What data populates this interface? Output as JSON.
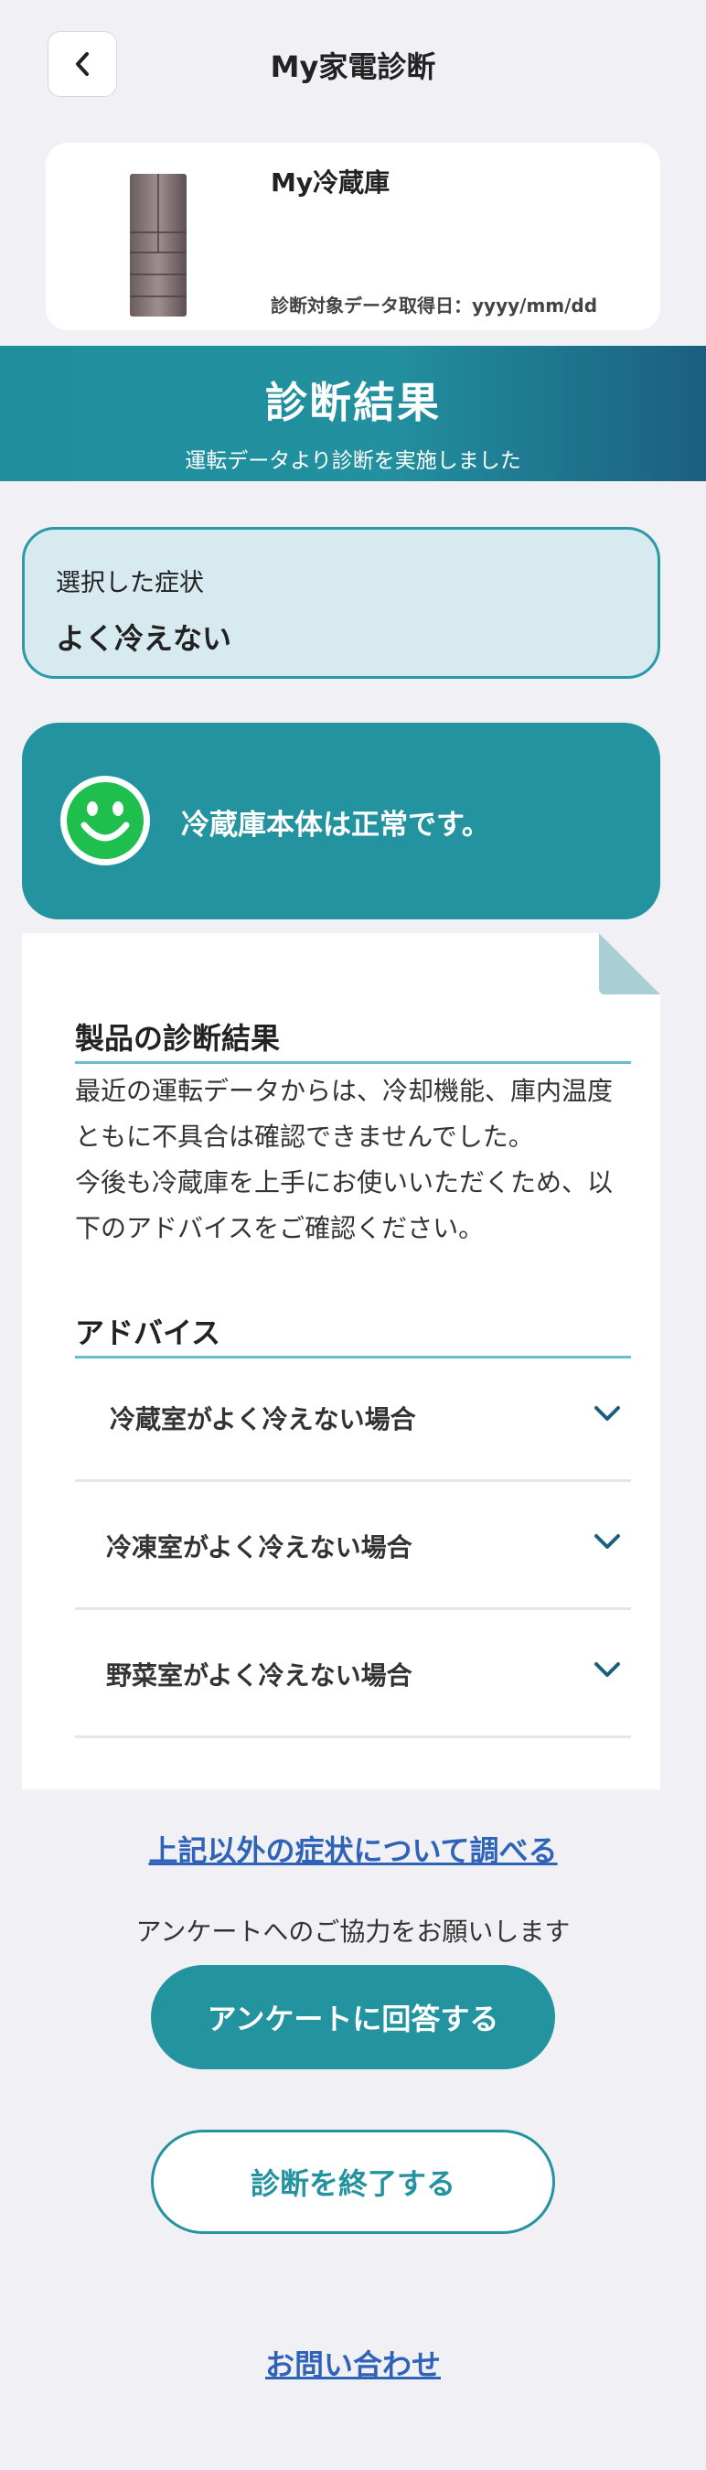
{
  "header": {
    "title": "My家電診断",
    "back_icon": "chevron-left-icon"
  },
  "product": {
    "name": "My冷蔵庫",
    "date_label": "診断対象データ取得日：yyyy/mm/dd",
    "image": "refrigerator-image"
  },
  "banner": {
    "title": "診断結果",
    "subtitle": "運転データより診断を実施しました"
  },
  "symptom": {
    "label": "選択した症状",
    "value": "よく冷えない"
  },
  "status": {
    "icon": "smile-icon",
    "text": "冷蔵庫本体は正常です。"
  },
  "result": {
    "heading": "製品の診断結果",
    "lines": [
      "最近の運転データからは、冷却機能、庫内温度",
      "ともに不具合は確認できませんでした。",
      "今後も冷蔵庫を上手にお使いいただくため、以",
      "下のアドバイスをご確認ください。"
    ]
  },
  "advice": {
    "heading": "アドバイス",
    "items": [
      {
        "label": "冷蔵室がよく冷えない場合"
      },
      {
        "label": "冷凍室がよく冷えない場合"
      },
      {
        "label": "野菜室がよく冷えない場合"
      }
    ]
  },
  "links": {
    "other_symptoms": "上記以外の症状について調べる",
    "contact": "お問い合わせ"
  },
  "survey": {
    "note": "アンケートへのご協力をお願いします",
    "button": "アンケートに回答する"
  },
  "end_button": "診断を終了する",
  "colors": {
    "accent": "#22939f",
    "background": "#f1f0f5",
    "link": "#2f63b8",
    "symptom_bg": "#d6eaf0"
  }
}
